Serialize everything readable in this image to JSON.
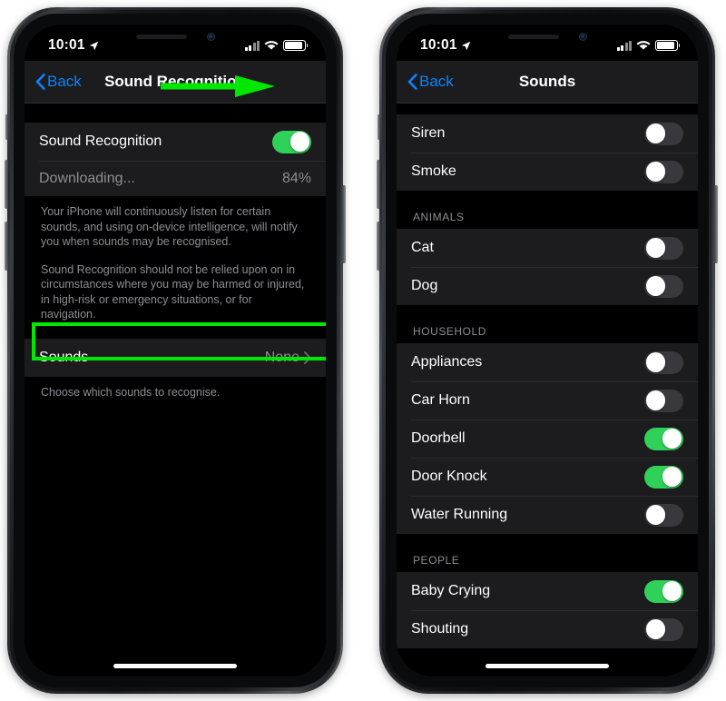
{
  "phones": [
    {
      "id": "sound-recognition",
      "statusbar": {
        "time": "10:01",
        "location_icon": "location-arrow-icon",
        "signal_icon": "cellular-signal-icon",
        "wifi_icon": "wifi-icon",
        "battery_icon": "battery-icon"
      },
      "nav": {
        "back_label": "Back",
        "title": "Sound Recognition"
      },
      "main_row": {
        "label": "Sound Recognition",
        "toggle_on": true
      },
      "progress_row": {
        "label": "Downloading...",
        "value": "84%"
      },
      "footnotes": [
        "Your iPhone will continuously listen for certain sounds, and using on-device intelligence, will notify you when sounds may be recognised.",
        "Sound Recognition should not be relied upon on in circumstances where you may be harmed or injured, in high-risk or emergency situations, or for navigation."
      ],
      "sounds_row": {
        "label": "Sounds",
        "value": "None",
        "chevron": "chevron-right-icon"
      },
      "sounds_footnote": "Choose which sounds to recognise."
    },
    {
      "id": "sounds-list",
      "statusbar": {
        "time": "10:01",
        "location_icon": "location-arrow-icon",
        "signal_icon": "cellular-signal-icon",
        "wifi_icon": "wifi-icon",
        "battery_icon": "battery-icon"
      },
      "nav": {
        "back_label": "Back",
        "title": "Sounds"
      },
      "sections": [
        {
          "header": "",
          "items": [
            {
              "label": "Siren",
              "on": false
            },
            {
              "label": "Smoke",
              "on": false
            }
          ]
        },
        {
          "header": "ANIMALS",
          "items": [
            {
              "label": "Cat",
              "on": false
            },
            {
              "label": "Dog",
              "on": false
            }
          ]
        },
        {
          "header": "HOUSEHOLD",
          "items": [
            {
              "label": "Appliances",
              "on": false
            },
            {
              "label": "Car Horn",
              "on": false
            },
            {
              "label": "Doorbell",
              "on": true
            },
            {
              "label": "Door Knock",
              "on": true
            },
            {
              "label": "Water Running",
              "on": false
            }
          ]
        },
        {
          "header": "PEOPLE",
          "items": [
            {
              "label": "Baby Crying",
              "on": true
            },
            {
              "label": "Shouting",
              "on": false
            }
          ]
        }
      ]
    }
  ],
  "annotations": {
    "arrow_color": "#00e800",
    "highlight_color": "#00e800",
    "arrow_target": "sound-recognition-toggle",
    "highlight_target": "sounds-row"
  },
  "colors": {
    "toggle_on": "#30d158",
    "toggle_off": "#39393d",
    "accent_blue": "#0a84ff",
    "group_bg": "#1c1c1e",
    "screen_bg": "#000000",
    "secondary_text": "#8e8e93"
  }
}
